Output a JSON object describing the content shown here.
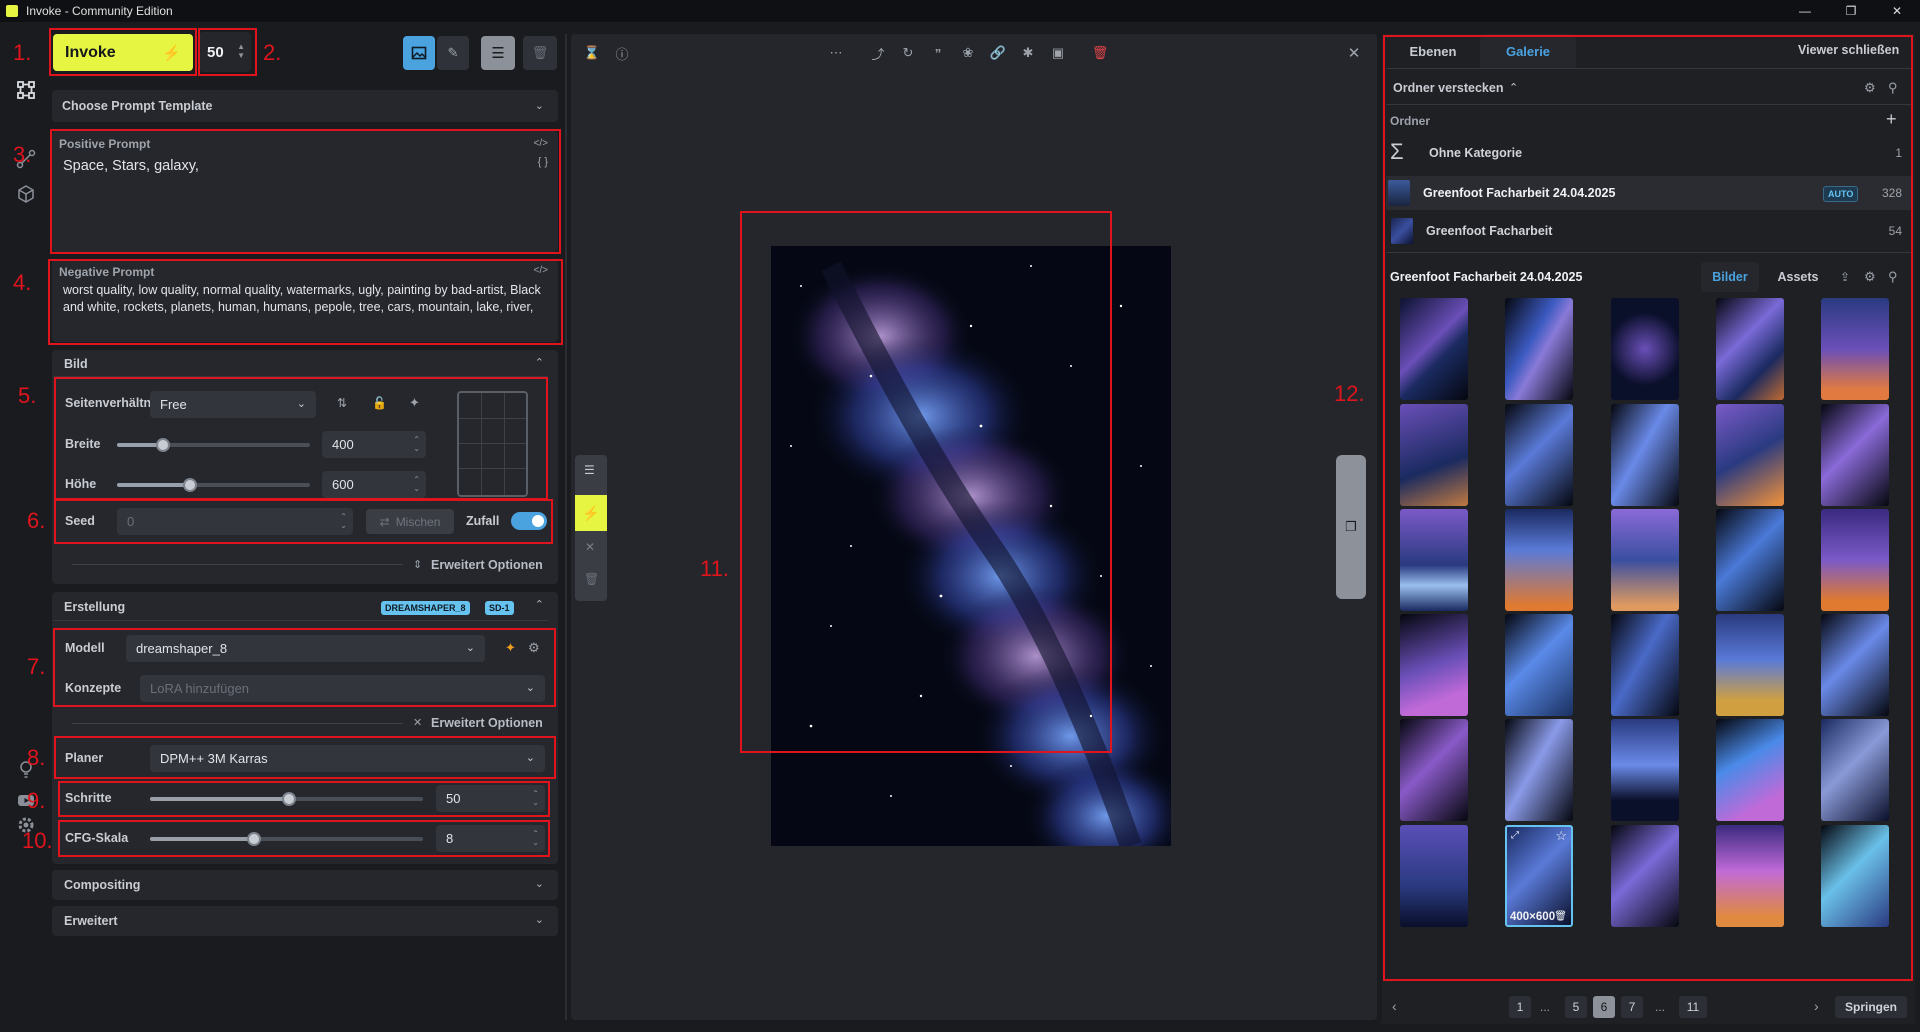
{
  "window": {
    "title": "Invoke - Community Edition"
  },
  "annotations": [
    "1.",
    "2.",
    "3.",
    "4.",
    "5.",
    "6.",
    "7.",
    "8.",
    "9.",
    "10.",
    "11.",
    "12."
  ],
  "top": {
    "invoke_label": "Invoke",
    "iterations": "50"
  },
  "prompt_template": "Choose Prompt Template",
  "positive": {
    "label": "Positive Prompt",
    "value": "Space, Stars, galaxy,"
  },
  "negative": {
    "label": "Negative Prompt",
    "value": "worst quality, low quality, normal quality, watermarks, ugly, painting by bad-artist, Black and white, rockets, planets, human, humans, pepole, tree, cars, mountain, lake, river,"
  },
  "bild": {
    "title": "Bild",
    "aspect_label": "Seitenverhältn",
    "aspect_value": "Free",
    "width_label": "Breite",
    "width": "400",
    "width_fraction": 0.24,
    "height_label": "Höhe",
    "height": "600",
    "height_fraction": 0.38,
    "seed_label": "Seed",
    "seed": "0",
    "shuffle_label": "Mischen",
    "random_label": "Zufall",
    "random_on": true,
    "advanced": "Erweitert Optionen"
  },
  "erstellung": {
    "title": "Erstellung",
    "badges": [
      "DREAMSHAPER_8",
      "SD-1"
    ],
    "model_label": "Modell",
    "model": "dreamshaper_8",
    "concepts_label": "Konzepte",
    "concepts_placeholder": "LoRA hinzufügen",
    "advanced": "Erweitert Optionen",
    "scheduler_label": "Planer",
    "scheduler": "DPM++ 3M Karras",
    "steps_label": "Schritte",
    "steps": "50",
    "steps_fraction": 0.51,
    "cfg_label": "CFG-Skala",
    "cfg": "8",
    "cfg_fraction": 0.38
  },
  "compositing": "Compositing",
  "erweitert": "Erweitert",
  "right": {
    "tabs": [
      "Ebenen",
      "Galerie"
    ],
    "active_tab": "Galerie",
    "close_viewer": "Viewer schließen",
    "hide_folders": "Ordner verstecken",
    "folders_label": "Ordner",
    "folders": [
      {
        "name": "Ohne Kategorie",
        "count": "1"
      },
      {
        "name": "Greenfoot Facharbeit 24.04.2025",
        "count": "328",
        "badge": "AUTO"
      },
      {
        "name": "Greenfoot Facharbeit",
        "count": "54"
      }
    ],
    "board_title": "Greenfoot Facharbeit 24.04.2025",
    "sub_tabs": [
      "Bilder",
      "Assets"
    ],
    "active_sub_tab": "Bilder",
    "selected_dims": "400×600",
    "pages": [
      "1",
      "...",
      "5",
      "6",
      "7",
      "...",
      "11"
    ],
    "active_page": "6",
    "jump": "Springen"
  },
  "colors": {
    "accent": "#e5f542",
    "blue": "#4aa3df",
    "annotation": "#e0141c"
  }
}
